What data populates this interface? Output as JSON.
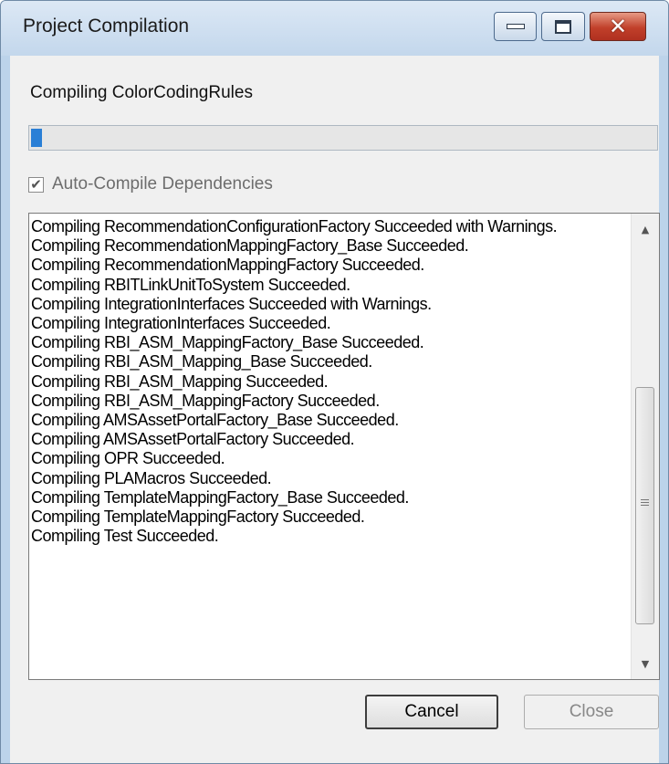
{
  "window": {
    "title": "Project Compilation",
    "controls": {
      "minimize": "minimize-icon",
      "maximize": "maximize-icon",
      "close": "close-icon"
    }
  },
  "status_text": "Compiling ColorCodingRules",
  "progress": {
    "value_percent": 2,
    "color": "#2a7fd6"
  },
  "auto_compile": {
    "label": "Auto-Compile Dependencies",
    "checked": true,
    "enabled": false
  },
  "log": {
    "lines": [
      "Compiling RecommendationConfigurationFactory Succeeded with Warnings.",
      "Compiling RecommendationMappingFactory_Base Succeeded.",
      "Compiling RecommendationMappingFactory Succeeded.",
      "Compiling RBITLinkUnitToSystem Succeeded.",
      "Compiling IntegrationInterfaces Succeeded with Warnings.",
      "Compiling IntegrationInterfaces Succeeded.",
      "Compiling RBI_ASM_MappingFactory_Base Succeeded.",
      "Compiling RBI_ASM_Mapping_Base Succeeded.",
      "Compiling RBI_ASM_Mapping Succeeded.",
      "Compiling RBI_ASM_MappingFactory Succeeded.",
      "Compiling AMSAssetPortalFactory_Base Succeeded.",
      "Compiling AMSAssetPortalFactory Succeeded.",
      "Compiling OPR Succeeded.",
      "Compiling PLAMacros Succeeded.",
      "Compiling TemplateMappingFactory_Base Succeeded.",
      "Compiling TemplateMappingFactory Succeeded.",
      "Compiling Test Succeeded."
    ]
  },
  "buttons": {
    "cancel": "Cancel",
    "close": "Close"
  }
}
